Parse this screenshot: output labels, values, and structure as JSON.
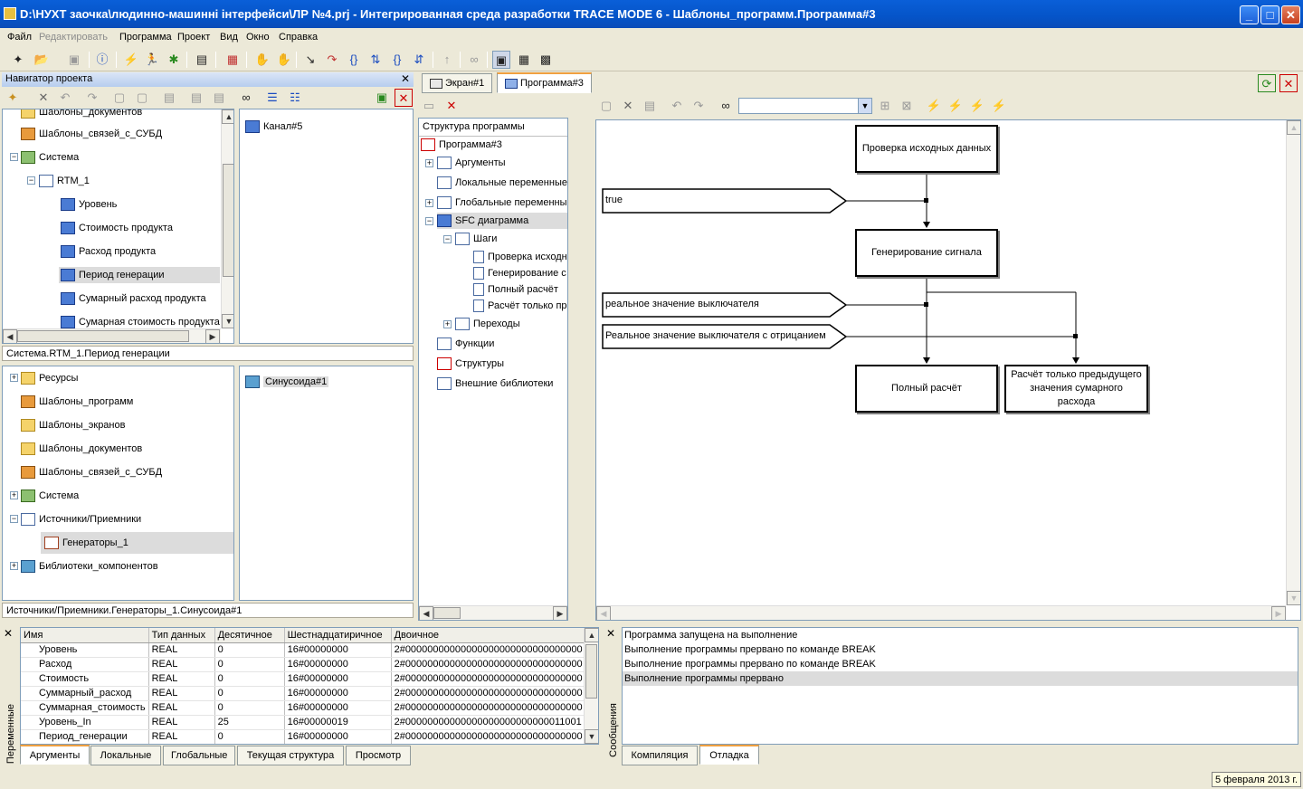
{
  "window": {
    "title": "D:\\НУХТ заочка\\людинно-машинні інтерфейси\\ЛР №4.prj - Интегрированная среда разработки TRACE MODE 6 - Шаблоны_программ.Программа#3"
  },
  "menu": [
    "Файл",
    "Редактировать",
    "Программа",
    "Проект",
    "Вид",
    "Окно",
    "Справка"
  ],
  "navigator": {
    "title": "Навигатор проекта",
    "top_tree": [
      {
        "label": "Шаблоны_документов",
        "icon": "folder-icon"
      },
      {
        "label": "Шаблоны_связей_с_СУБД",
        "icon": "folder-icon"
      },
      {
        "label": "Система",
        "icon": "network-icon"
      },
      {
        "label": "RTM_1",
        "icon": "computer-icon"
      },
      {
        "label": "Уровень",
        "icon": "channel-icon"
      },
      {
        "label": "Стоимость продукта",
        "icon": "channel-icon"
      },
      {
        "label": "Расход продукта",
        "icon": "channel-icon"
      },
      {
        "label": "Период генерации",
        "icon": "channel-icon"
      },
      {
        "label": "Сумарный расход продукта",
        "icon": "channel-icon"
      },
      {
        "label": "Сумарная стоимость продукта",
        "icon": "channel-icon"
      }
    ],
    "top_right_item": "Канал#5",
    "top_path": "Система.RTM_1.Период генерации",
    "bottom_tree": [
      {
        "label": "Ресурсы"
      },
      {
        "label": "Шаблоны_программ"
      },
      {
        "label": "Шаблоны_экранов"
      },
      {
        "label": "Шаблоны_документов"
      },
      {
        "label": "Шаблоны_связей_с_СУБД"
      },
      {
        "label": "Система"
      },
      {
        "label": "Источники/Приемники"
      },
      {
        "label": "Генераторы_1"
      },
      {
        "label": "Библиотеки_компонентов"
      }
    ],
    "bottom_right_item": "Синусоида#1",
    "bottom_path": "Источники/Приемники.Генераторы_1.Синусоида#1"
  },
  "doc_tabs": [
    "Экран#1",
    "Программа#3"
  ],
  "structure": {
    "title": "Структура программы",
    "items": [
      "Программа#3",
      "Аргументы",
      "Локальные переменные",
      "Глобальные переменные",
      "SFC диаграмма",
      "Шаги",
      "Проверка исходн",
      "Генерирование с",
      "Полный расчёт",
      "Расчёт только пр",
      "Переходы",
      "Функции",
      "Структуры",
      "Внешние библиотеки"
    ]
  },
  "sfc": {
    "steps": {
      "check": "Проверка исходных данных",
      "gen": "Генерирование сигнала",
      "full": "Полный расчёт",
      "partial": "Расчёт только предыдущего значения сумарного расхода"
    },
    "transitions": {
      "t1": "true",
      "t2": "реальное значение выключателя",
      "t3": "Реальное значение выключателя с отрицанием"
    }
  },
  "variables": {
    "side_label": "Переменные",
    "columns": [
      "Имя",
      "Тип данных",
      "Десятичное",
      "Шестнадцатиричное",
      "Двоичное"
    ],
    "rows": [
      [
        "Уровень",
        "REAL",
        "0",
        "16#00000000",
        "2#00000000000000000000000000000000"
      ],
      [
        "Расход",
        "REAL",
        "0",
        "16#00000000",
        "2#00000000000000000000000000000000"
      ],
      [
        "Стоимость",
        "REAL",
        "0",
        "16#00000000",
        "2#00000000000000000000000000000000"
      ],
      [
        "Суммарный_расход",
        "REAL",
        "0",
        "16#00000000",
        "2#00000000000000000000000000000000"
      ],
      [
        "Суммарная_стоимость",
        "REAL",
        "0",
        "16#00000000",
        "2#00000000000000000000000000000000"
      ],
      [
        "Уровень_In",
        "REAL",
        "25",
        "16#00000019",
        "2#00000000000000000000000000011001"
      ],
      [
        "Период_генерации",
        "REAL",
        "0",
        "16#00000000",
        "2#00000000000000000000000000000000"
      ]
    ],
    "tabs": [
      "Аргументы",
      "Локальные",
      "Глобальные",
      "Текущая структура",
      "Просмотр"
    ]
  },
  "messages": {
    "side_label": "Сообщения",
    "lines": [
      "Программа запущена на выполнение",
      "Выполнение программы прервано по команде BREAK",
      "Выполнение программы прервано по команде BREAK",
      "Выполнение программы прервано"
    ],
    "tabs": [
      "Компиляция",
      "Отладка"
    ]
  },
  "status": {
    "date": "5 февраля 2013 г."
  }
}
